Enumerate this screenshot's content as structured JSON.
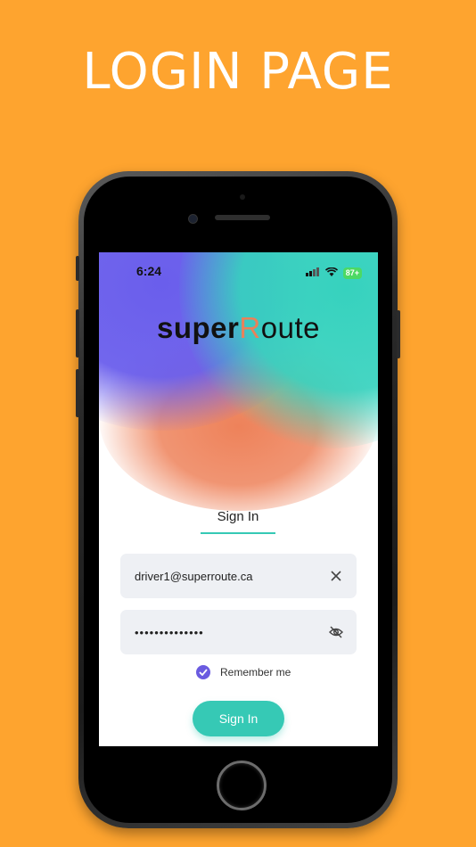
{
  "banner": {
    "title": "LOGIN PAGE"
  },
  "status_bar": {
    "time": "6:24",
    "battery": "87+"
  },
  "logo": {
    "bold_part": "super",
    "accent_letter": "R",
    "rest": "oute"
  },
  "tabs": [
    {
      "label": "Sign In",
      "active": true
    }
  ],
  "form": {
    "email": {
      "value": "driver1@superroute.ca"
    },
    "password": {
      "value": "••••••••••••••"
    },
    "remember": {
      "label": "Remember me",
      "checked": true
    },
    "submit_label": "Sign In"
  },
  "colors": {
    "background": "#FEA42F",
    "accent_teal": "#36c9b5",
    "accent_purple": "#6a5be0",
    "accent_orange": "#e8825a"
  },
  "icons": {
    "email_clear": "close-icon",
    "password_toggle": "eye-off-icon",
    "checkbox": "check-icon"
  }
}
